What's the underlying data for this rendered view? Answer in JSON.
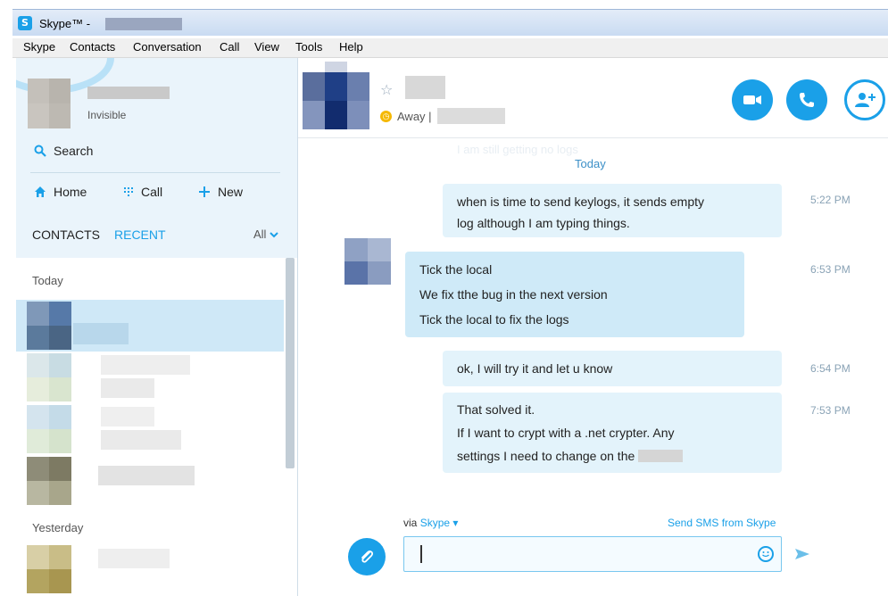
{
  "window": {
    "title": "Skype™ -",
    "logo_letter": "S"
  },
  "menu": [
    "Skype",
    "Contacts",
    "Conversation",
    "Call",
    "View",
    "Tools",
    "Help"
  ],
  "sidebar": {
    "profile_status": "Invisible",
    "search_label": "Search",
    "nav": {
      "home": "Home",
      "call": "Call",
      "new": "New"
    },
    "tabs": {
      "contacts": "CONTACTS",
      "recent": "RECENT"
    },
    "filter": "All",
    "sections": {
      "today": "Today",
      "yesterday": "Yesterday"
    }
  },
  "header": {
    "status": "Away |",
    "icons": [
      "video-call-icon",
      "call-icon",
      "add-contact-icon"
    ]
  },
  "conversation": {
    "ghost_text": "I am still getting no logs",
    "day_label": "Today",
    "messages": [
      {
        "lines": [
          "when is time to send keylogs, it sends empty",
          "log although I am typing things."
        ],
        "time": "5:22 PM"
      },
      {
        "lines": [
          "Tick the local",
          "We fix tthe bug in the next version",
          "Tick the local to fix the logs"
        ],
        "time": "6:53 PM"
      },
      {
        "lines": [
          "ok, I will try it and let u know"
        ],
        "time": "6:54 PM"
      },
      {
        "lines": [
          "That solved it.",
          "If I want to crypt with a .net crypter. Any",
          "settings I need to change on the"
        ],
        "time": "7:53 PM"
      }
    ]
  },
  "compose": {
    "via_label": "via",
    "via_link": "Skype",
    "sms_link": "Send SMS from Skype"
  },
  "colors": {
    "accent": "#1aa0e8",
    "bubble_me": "#e3f3fb",
    "bubble_them": "#cfeaf8",
    "sidebar_bg": "#eaf4fb"
  }
}
